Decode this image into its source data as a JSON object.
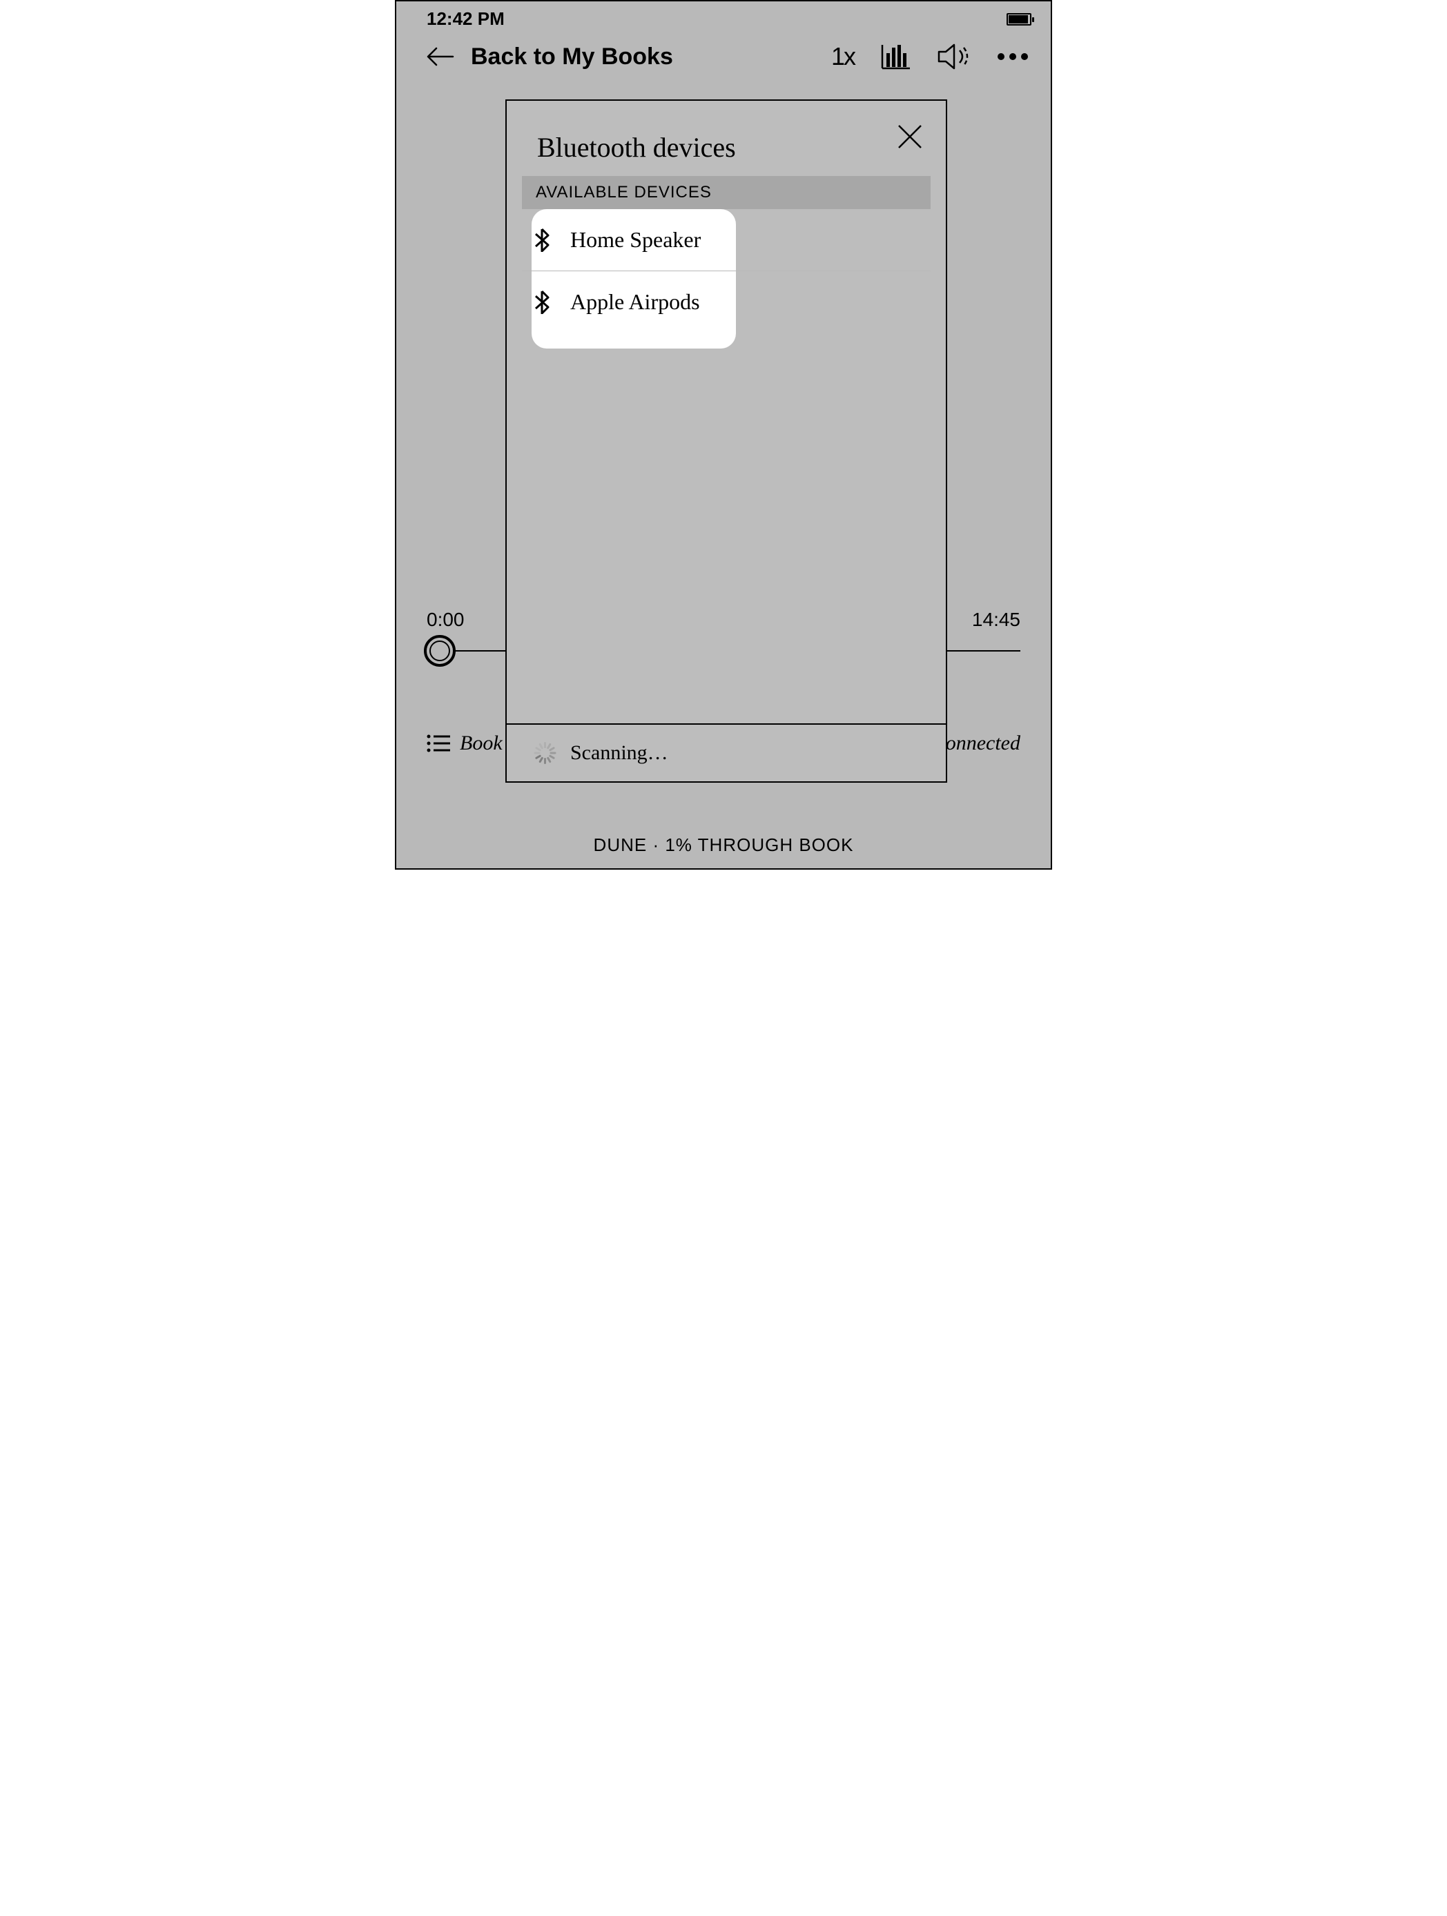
{
  "status": {
    "time": "12:42 PM"
  },
  "nav": {
    "back_label": "Back to My Books",
    "speed": "1x"
  },
  "player": {
    "elapsed": "0:00",
    "remaining": "14:45",
    "contents_label": "Book contents",
    "connection_status": "No speaker connected"
  },
  "footer": {
    "caption": "DUNE · 1% THROUGH BOOK"
  },
  "modal": {
    "title": "Bluetooth devices",
    "section_header": "AVAILABLE DEVICES",
    "devices": [
      {
        "name": "Home Speaker"
      },
      {
        "name": "Apple Airpods"
      }
    ],
    "status": "Scanning…"
  }
}
